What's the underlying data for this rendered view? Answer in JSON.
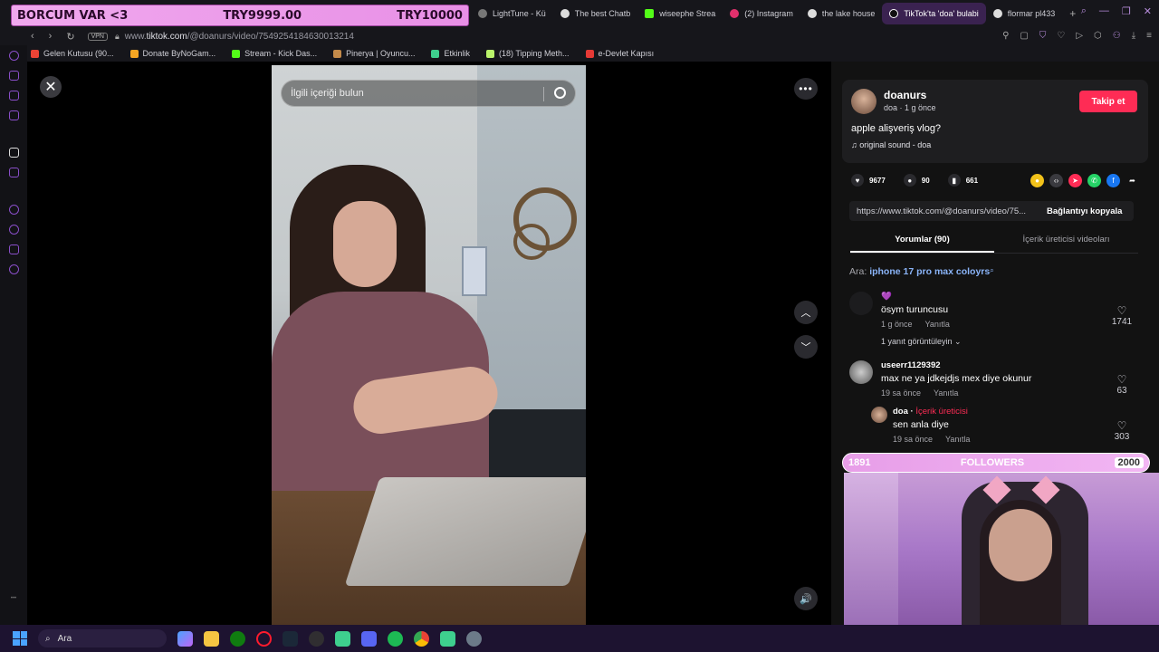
{
  "donation": {
    "title": "BORCUM VAR <3",
    "current": "TRY9999.00",
    "goal": "TRY10000"
  },
  "tabs": [
    {
      "label": "LightTune - Kü",
      "color": "#777"
    },
    {
      "label": "The best Chatb",
      "color": "#ddd"
    },
    {
      "label": "wiseephe Strea",
      "color": "#53fc18"
    },
    {
      "label": "(2) Instagram",
      "color": "#e1306c"
    },
    {
      "label": "the lake house",
      "color": "#ddd"
    },
    {
      "label": "TikTok'ta 'doa' bulabi",
      "color": "#fff",
      "active": true
    },
    {
      "label": "flormar pl433",
      "color": "#ddd"
    }
  ],
  "newtab": "+",
  "address": {
    "vpn": "VPN",
    "url_prefix": "www.",
    "url_domain": "tiktok.com",
    "url_path": "/@doanurs/video/7549254184630013214"
  },
  "bookmarks": [
    {
      "label": "Gelen Kutusu (90...",
      "color": "#ea4335"
    },
    {
      "label": "Donate ByNoGam...",
      "color": "#f5a623"
    },
    {
      "label": "Stream - Kick Das...",
      "color": "#53fc18"
    },
    {
      "label": "Pinerya | Oyuncu...",
      "color": "#c48a4a"
    },
    {
      "label": "Etkinlik",
      "color": "#3ecf8e"
    },
    {
      "label": "(18) Tipping Meth...",
      "color": "#b9f26a"
    },
    {
      "label": "e-Devlet Kapısı",
      "color": "#e53935"
    }
  ],
  "player": {
    "search_placeholder": "İlgili içeriği bulun",
    "close_icon": "close-icon",
    "more_label": "•••",
    "up_glyph": "︿",
    "down_glyph": "﹀",
    "volume_glyph": "🔊"
  },
  "post": {
    "username": "doanurs",
    "subline": "doa · 1 g önce",
    "follow_label": "Takip et",
    "caption": "apple alişveriş vlog?",
    "sound": "♫  original sound - doa",
    "likes": "9677",
    "comments": "90",
    "saves": "661",
    "link": "https://www.tiktok.com/@doanurs/video/75...",
    "copy_label": "Bağlantıyı kopyala"
  },
  "panel_tabs": {
    "comments": "Yorumlar (90)",
    "creator_videos": "İçerik üreticisi videoları"
  },
  "search_hint": {
    "prefix": "Ara:",
    "query": "iphone 17 pro max coloyrs"
  },
  "comments": [
    {
      "name": "💜",
      "text": "ösym turuncusu",
      "time": "1 g önce",
      "reply": "Yanıtla",
      "likes": "1741"
    },
    {
      "name": "useerr1129392",
      "text": "max ne ya jdkejdjs mex diye okunur",
      "time": "19 sa önce",
      "reply": "Yanıtla",
      "likes": "63"
    },
    {
      "name": "doa",
      "creator_badge": "İçerik üreticisi",
      "text": "sen anla diye",
      "time": "19 sa önce",
      "reply": "Yanıtla",
      "likes": "303"
    }
  ],
  "view_replies": "1 yanıt görüntüleyin ⌄",
  "followers_goal": {
    "current": "1891",
    "label": "FOLLOWERS",
    "goal": "2000"
  },
  "taskbar": {
    "search_label": "Ara"
  },
  "colors": {
    "accent_pink": "#fe2c55",
    "overlay_pink": "#e79ee8",
    "browser_purple": "#8a4fc9"
  }
}
